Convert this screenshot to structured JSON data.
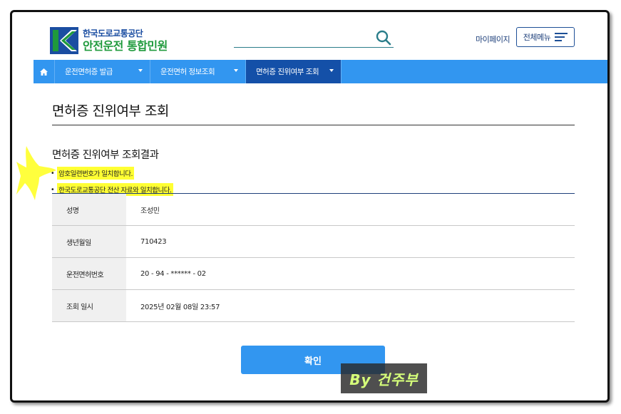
{
  "header": {
    "org_name": "한국도로교통공단",
    "service_name": "안전운전 통합민원",
    "search": {
      "placeholder": "",
      "icon": "search-icon"
    },
    "my_page": "마이페이지",
    "all_menu": "전체메뉴"
  },
  "nav": {
    "home_icon": "home-icon",
    "items": [
      {
        "label": "운전면허증 발급"
      },
      {
        "label": "운전면허 정보조회"
      },
      {
        "label": "면허증 진위여부 조회"
      }
    ]
  },
  "page": {
    "title": "면허증 진위여부 조회",
    "section_title": "면허증 진위여부 조회결과",
    "bullets": [
      "암호일련번호가 일치합니다.",
      "한국도로교통공단 전산 자료와 일치합니다."
    ]
  },
  "result": {
    "rows": [
      {
        "label": "성명",
        "value": "조성민"
      },
      {
        "label": "생년월일",
        "value": "710423"
      },
      {
        "label": "운전면허번호",
        "value": "20 - 94 - ****** - 02"
      },
      {
        "label": "조회 일시",
        "value": "2025년 02월 08일 23:57"
      }
    ]
  },
  "confirm_label": "확인",
  "watermark": "By 건주부",
  "colors": {
    "nav": "#3296f0",
    "nav_active": "#1450a8",
    "highlight": "#ffff33",
    "logo_blue": "#1a4da1",
    "logo_green": "#1f9a3c"
  }
}
